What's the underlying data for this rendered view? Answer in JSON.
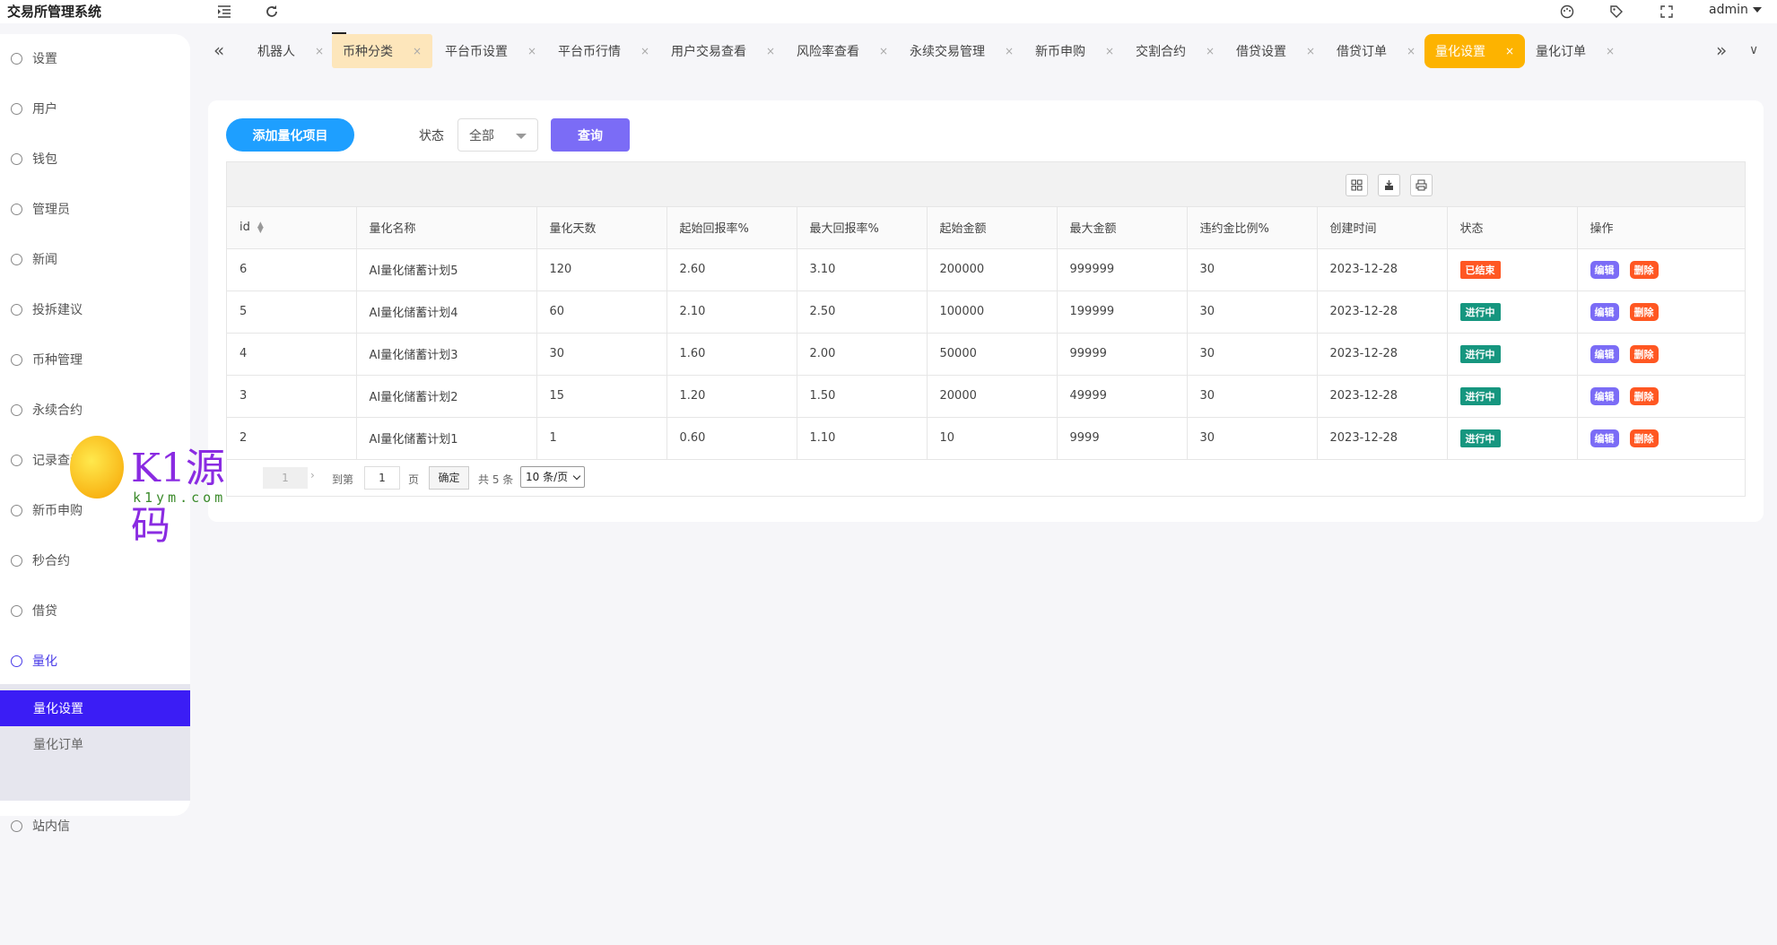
{
  "header": {
    "app_title": "交易所管理系统",
    "user": "admin",
    "icons": [
      "menu-fold-icon",
      "refresh-icon",
      "theme-icon",
      "tag-icon",
      "fullscreen-icon"
    ]
  },
  "sidebar": {
    "items": [
      {
        "label": "设置",
        "icon": "gear-icon"
      },
      {
        "label": "用户",
        "icon": "user-icon"
      },
      {
        "label": "钱包",
        "icon": "wallet-icon"
      },
      {
        "label": "管理员",
        "icon": "shield-icon"
      },
      {
        "label": "新闻",
        "icon": "tag-icon"
      },
      {
        "label": "投拆建议",
        "icon": "link-icon"
      },
      {
        "label": "币种管理",
        "icon": "diamond-icon"
      },
      {
        "label": "永续合约",
        "icon": "diamond-icon"
      },
      {
        "label": "记录查看",
        "icon": "clock-icon"
      },
      {
        "label": "新币申购",
        "icon": "coin-icon"
      },
      {
        "label": "秒合约",
        "icon": "clock-icon"
      },
      {
        "label": "借贷",
        "icon": "clock-icon"
      },
      {
        "label": "量化",
        "icon": "clock-icon"
      },
      {
        "label": "站内信",
        "icon": "bell-icon"
      }
    ],
    "sub_items": [
      {
        "label": "量化设置",
        "active": true
      },
      {
        "label": "量化订单",
        "active": false
      }
    ]
  },
  "tabs": [
    {
      "label": "机器人"
    },
    {
      "label": "币种分类",
      "home": true
    },
    {
      "label": "平台币设置"
    },
    {
      "label": "平台币行情"
    },
    {
      "label": "用户交易查看"
    },
    {
      "label": "风险率查看"
    },
    {
      "label": "永续交易管理"
    },
    {
      "label": "新币申购"
    },
    {
      "label": "交割合约"
    },
    {
      "label": "借贷设置"
    },
    {
      "label": "借贷订单"
    },
    {
      "label": "量化设置",
      "active": true
    },
    {
      "label": "量化订单"
    }
  ],
  "toolbar": {
    "add_label": "添加量化项目",
    "filter_label": "状态",
    "filter_value": "全部",
    "query_label": "查询"
  },
  "table": {
    "columns": [
      "id",
      "量化名称",
      "量化天数",
      "起始回报率%",
      "最大回报率%",
      "起始金额",
      "最大金额",
      "违约金比例%",
      "创建时间",
      "状态",
      "操作"
    ],
    "rows": [
      {
        "id": "6",
        "name": "AI量化储蓄计划5",
        "days": "120",
        "start_rate": "2.60",
        "max_rate": "3.10",
        "start_amount": "200000",
        "max_amount": "999999",
        "penalty": "30",
        "created": "2023-12-28",
        "status": "已结束",
        "status_type": "ended"
      },
      {
        "id": "5",
        "name": "AI量化储蓄计划4",
        "days": "60",
        "start_rate": "2.10",
        "max_rate": "2.50",
        "start_amount": "100000",
        "max_amount": "199999",
        "penalty": "30",
        "created": "2023-12-28",
        "status": "进行中",
        "status_type": "running"
      },
      {
        "id": "4",
        "name": "AI量化储蓄计划3",
        "days": "30",
        "start_rate": "1.60",
        "max_rate": "2.00",
        "start_amount": "50000",
        "max_amount": "99999",
        "penalty": "30",
        "created": "2023-12-28",
        "status": "进行中",
        "status_type": "running"
      },
      {
        "id": "3",
        "name": "AI量化储蓄计划2",
        "days": "15",
        "start_rate": "1.20",
        "max_rate": "1.50",
        "start_amount": "20000",
        "max_amount": "49999",
        "penalty": "30",
        "created": "2023-12-28",
        "status": "进行中",
        "status_type": "running"
      },
      {
        "id": "2",
        "name": "AI量化储蓄计划1",
        "days": "1",
        "start_rate": "0.60",
        "max_rate": "1.10",
        "start_amount": "10",
        "max_amount": "9999",
        "penalty": "30",
        "created": "2023-12-28",
        "status": "进行中",
        "status_type": "running"
      }
    ],
    "edit_label": "编辑",
    "delete_label": "删除"
  },
  "pager": {
    "current": "1",
    "goto_label": "到第",
    "goto_value": "1",
    "page_label": "页",
    "ok_label": "确定",
    "total": "共 5 条",
    "page_size": "10 条/页"
  },
  "watermark": {
    "text": "K1源码",
    "url": "k1ym.com"
  },
  "colors": {
    "primary": "#1e9fff",
    "accent_tab": "#fdb300",
    "sidebar_active": "#3b1df5",
    "query": "#7b6cf6",
    "ended": "#ff5722",
    "running": "#16967f"
  }
}
